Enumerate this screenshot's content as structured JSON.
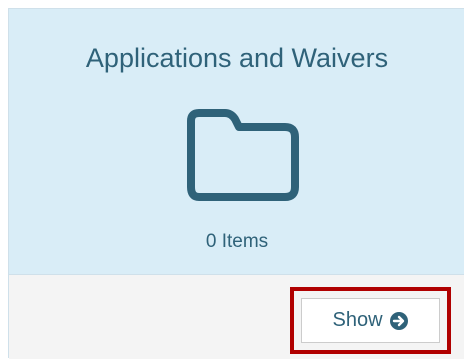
{
  "card": {
    "title": "Applications and Waivers",
    "icon": "folder-icon",
    "item_count": "0 Items",
    "show_button_label": "Show",
    "show_button_icon": "arrow-circle-right-icon"
  },
  "colors": {
    "card_background": "#d9edf7",
    "text_accent": "#2f6279",
    "highlight_border": "#b00000",
    "footer_background": "#f4f4f4"
  }
}
